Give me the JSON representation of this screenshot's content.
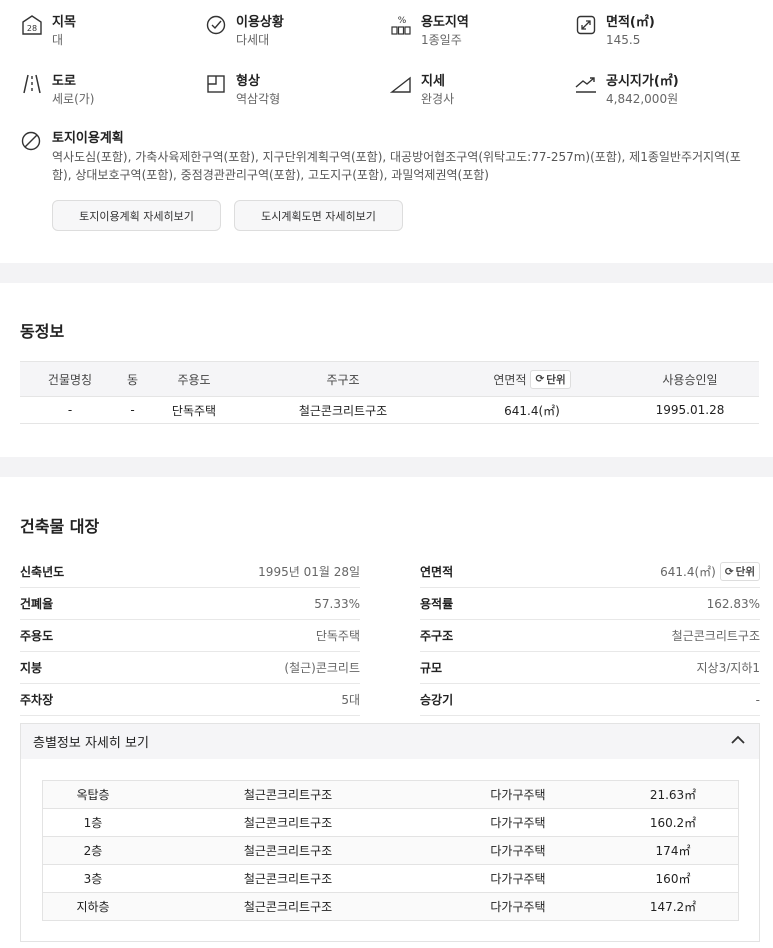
{
  "land": {
    "items": [
      {
        "icon": "lot-number-icon",
        "label": "지목",
        "value": "대"
      },
      {
        "icon": "check-circle-icon",
        "label": "이용상황",
        "value": "다세대"
      },
      {
        "icon": "zoning-icon",
        "label": "용도지역",
        "value": "1종일주"
      },
      {
        "icon": "area-expand-icon",
        "label": "면적(㎡)",
        "value": "145.5"
      },
      {
        "icon": "road-icon",
        "label": "도로",
        "value": "세로(가)"
      },
      {
        "icon": "shape-icon",
        "label": "형상",
        "value": "역삼각형"
      },
      {
        "icon": "slope-icon",
        "label": "지세",
        "value": "완경사"
      },
      {
        "icon": "trend-icon",
        "label": "공시지가(㎡)",
        "value": "4,842,000원"
      }
    ],
    "plan_label": "토지이용계획",
    "plan_value": "역사도심(포함), 가축사육제한구역(포함), 지구단위계획구역(포함), 대공방어협조구역(위탁고도:77-257m)(포함), 제1종일반주거지역(포함), 상대보호구역(포함), 중점경관관리구역(포함), 고도지구(포함), 과밀억제권역(포함)",
    "btn_plan": "토지이용계획 자세히보기",
    "btn_city": "도시계획도면 자세히보기"
  },
  "dong": {
    "title": "동정보",
    "headers": [
      "건물명칭",
      "동",
      "주용도",
      "주구조",
      "연면적",
      "사용승인일"
    ],
    "unit_label": "단위",
    "row": [
      "-",
      "-",
      "단독주택",
      "철근콘크리트구조",
      "641.4(㎡)",
      "1995.01.28"
    ]
  },
  "ledger": {
    "title": "건축물 대장",
    "left": [
      {
        "k": "신축년도",
        "v": "1995년 01월 28일"
      },
      {
        "k": "건폐율",
        "v": "57.33%"
      },
      {
        "k": "주용도",
        "v": "단독주택"
      },
      {
        "k": "지붕",
        "v": "(철근)콘크리트"
      },
      {
        "k": "주차장",
        "v": "5대"
      }
    ],
    "right": [
      {
        "k": "연면적",
        "v": "641.4(㎡)"
      },
      {
        "k": "용적률",
        "v": "162.83%"
      },
      {
        "k": "주구조",
        "v": "철근콘크리트구조"
      },
      {
        "k": "규모",
        "v": "지상3/지하1"
      },
      {
        "k": "승강기",
        "v": "-"
      }
    ],
    "unit_label": "단위",
    "floor_toggle": "층별정보 자세히 보기",
    "floors": [
      [
        "옥탑층",
        "철근콘크리트구조",
        "다가구주택",
        "21.63㎡"
      ],
      [
        "1층",
        "철근콘크리트구조",
        "다가구주택",
        "160.2㎡"
      ],
      [
        "2층",
        "철근콘크리트구조",
        "다가구주택",
        "174㎡"
      ],
      [
        "3층",
        "철근콘크리트구조",
        "다가구주택",
        "160㎡"
      ],
      [
        "지하층",
        "철근콘크리트구조",
        "다가구주택",
        "147.2㎡"
      ]
    ]
  }
}
